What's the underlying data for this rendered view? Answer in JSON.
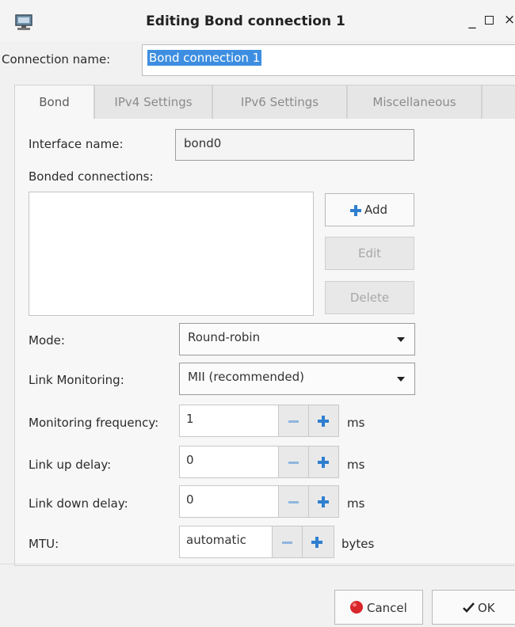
{
  "window": {
    "title": "Editing Bond connection 1",
    "minimize_glyph": "_",
    "close_glyph": "×"
  },
  "connection": {
    "label": "Connection name:",
    "value": "Bond connection 1"
  },
  "tabs": [
    {
      "label": "Bond",
      "active": true
    },
    {
      "label": "IPv4 Settings",
      "active": false
    },
    {
      "label": "IPv6 Settings",
      "active": false
    },
    {
      "label": "Miscellaneous",
      "active": false
    }
  ],
  "bond": {
    "interface_label": "Interface name:",
    "interface_value": "bond0",
    "bonded_label": "Bonded connections:",
    "add_label": "Add",
    "edit_label": "Edit",
    "delete_label": "Delete",
    "mode_label": "Mode:",
    "mode_value": "Round-robin",
    "link_monitoring_label": "Link Monitoring:",
    "link_monitoring_value": "MII (recommended)",
    "monitoring_frequency_label": "Monitoring frequency:",
    "monitoring_frequency_value": "1",
    "monitoring_frequency_unit": "ms",
    "link_up_label": "Link up delay:",
    "link_up_value": "0",
    "link_up_unit": "ms",
    "link_down_label": "Link down delay:",
    "link_down_value": "0",
    "link_down_unit": "ms",
    "mtu_label": "MTU:",
    "mtu_value": "automatic",
    "mtu_unit": "bytes"
  },
  "footer": {
    "cancel_label": "Cancel",
    "ok_label": "OK"
  },
  "colors": {
    "accent": "#3d8ee0",
    "plus_icon": "#2f7fcf",
    "cancel_icon": "#d9262c"
  },
  "icons": [
    "network-connections-icon",
    "plus-icon",
    "minus-icon",
    "cancel-icon",
    "checkmark-icon",
    "chevron-down-icon"
  ]
}
